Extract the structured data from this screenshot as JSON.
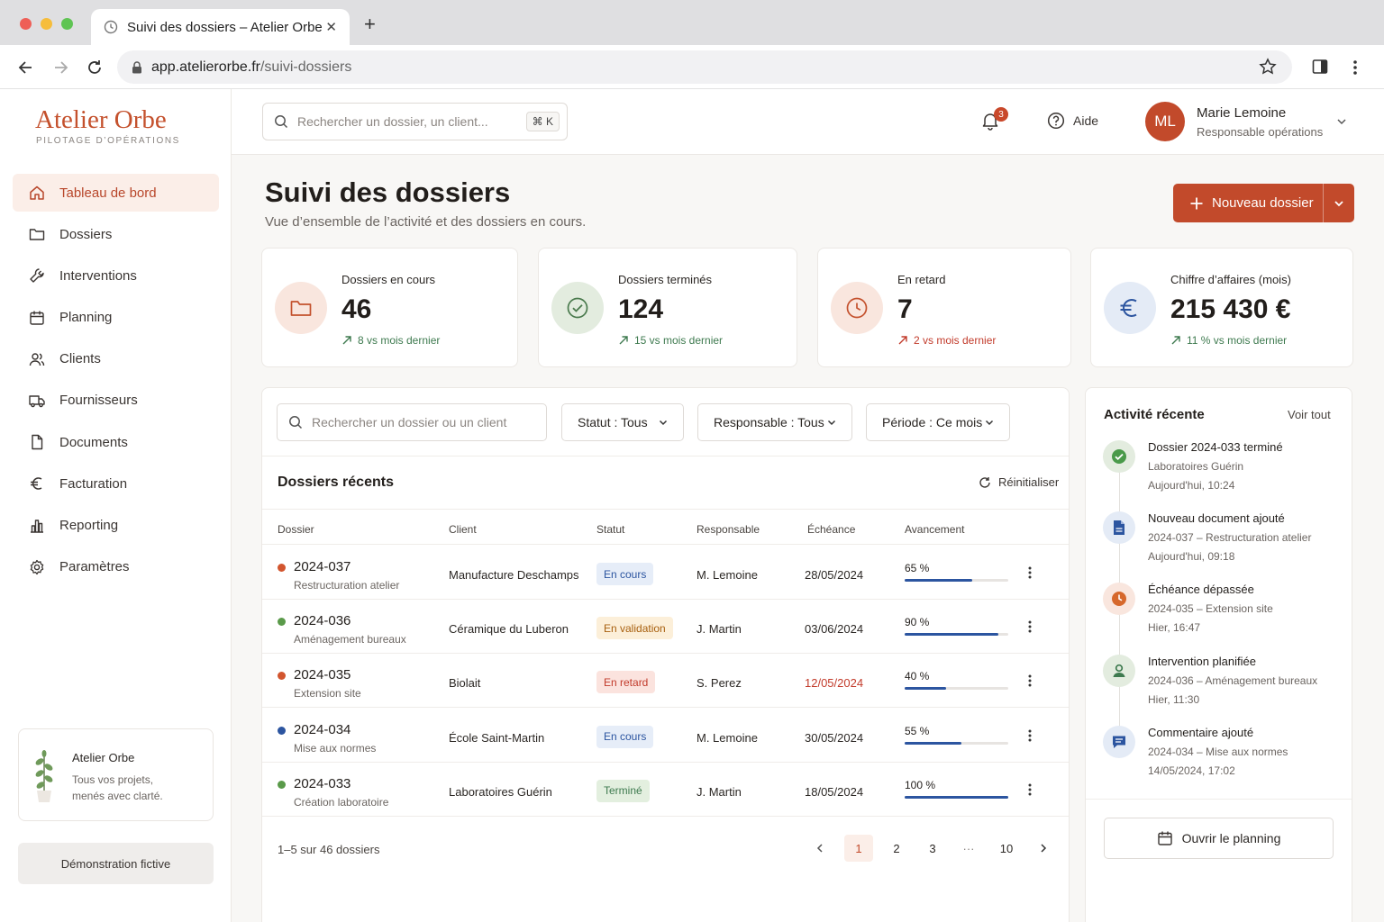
{
  "browser": {
    "tab_title": "Suivi des dossiers – Atelier Orbe",
    "url_host": "app.atelierorbe.fr",
    "url_path": "/suivi-dossiers"
  },
  "brand": {
    "name": "Atelier Orbe",
    "tagline": "PILOTAGE D’OPÉRATIONS",
    "accent": "#c24a2b"
  },
  "sidebar": {
    "items": [
      {
        "label": "Tableau de bord",
        "icon": "home-icon",
        "active": true
      },
      {
        "label": "Dossiers",
        "icon": "folder-icon"
      },
      {
        "label": "Interventions",
        "icon": "wrench-icon"
      },
      {
        "label": "Planning",
        "icon": "calendar-icon"
      },
      {
        "label": "Clients",
        "icon": "users-icon"
      },
      {
        "label": "Fournisseurs",
        "icon": "truck-icon"
      },
      {
        "label": "Documents",
        "icon": "document-icon"
      },
      {
        "label": "Facturation",
        "icon": "euro-icon"
      },
      {
        "label": "Reporting",
        "icon": "bar-chart-icon"
      },
      {
        "label": "Paramètres",
        "icon": "gear-icon"
      }
    ],
    "promo": {
      "title": "Atelier Orbe",
      "text": "Tous vos projets, menés avec clarté."
    },
    "demo_label": "Démonstration fictive"
  },
  "topbar": {
    "search_placeholder": "Rechercher un dossier, un client...",
    "shortcut": "⌘ K",
    "notifications_count": "3",
    "help_label": "Aide",
    "user": {
      "initials": "ML",
      "name": "Marie Lemoine",
      "role": "Responsable opérations"
    }
  },
  "page": {
    "title": "Suivi des dossiers",
    "subtitle": "Vue d’ensemble de l’activité et des dossiers en cours.",
    "new_button": "Nouveau dossier"
  },
  "kpis": [
    {
      "label": "Dossiers en cours",
      "value": "46",
      "trend": "8 vs mois dernier",
      "icon": "folder-icon",
      "color": "#c4512d",
      "bg": "#f9e6de",
      "trend_color": "#3e7a4f"
    },
    {
      "label": "Dossiers terminés",
      "value": "124",
      "trend": "15 vs mois dernier",
      "icon": "check-circle-icon",
      "color": "#4a7a4d",
      "bg": "#e3ecdf",
      "trend_color": "#3e7a4f"
    },
    {
      "label": "En retard",
      "value": "7",
      "trend": "2 vs mois dernier",
      "icon": "clock-icon",
      "color": "#c4512d",
      "bg": "#f9e6de",
      "trend_color": "#c23b2b"
    },
    {
      "label": "Chiffre d’affaires (mois)",
      "value": "215 430 €",
      "trend": "11 % vs mois dernier",
      "icon": "euro-icon",
      "color": "#2c55a0",
      "bg": "#e4ebf6",
      "trend_color": "#3e7a4f"
    }
  ],
  "filters": {
    "search_placeholder": "Rechercher un dossier ou un client",
    "status": "Statut : Tous",
    "owner": "Responsable : Tous",
    "period": "Période : Ce mois"
  },
  "table": {
    "title": "Dossiers récents",
    "reset_label": "Réinitialiser",
    "columns": [
      "Dossier",
      "Client",
      "Statut",
      "Responsable",
      "Échéance",
      "Avancement"
    ],
    "rows": [
      {
        "id": "2024-037",
        "desc": "Restructuration atelier",
        "client": "Manufacture Deschamps",
        "status": "En cours",
        "owner": "M. Lemoine",
        "due": "28/05/2024",
        "progress_label": "65 %",
        "progress": 0.65,
        "dot": "#d2552e",
        "pill_fg": "#2c55a0",
        "pill_bg": "#e6edf8",
        "due_color": "#2b2724"
      },
      {
        "id": "2024-036",
        "desc": "Aménagement bureaux",
        "client": "Céramique du Luberon",
        "status": "En validation",
        "owner": "J. Martin",
        "due": "03/06/2024",
        "progress_label": "90 %",
        "progress": 0.9,
        "dot": "#5a9a4a",
        "pill_fg": "#a8600f",
        "pill_bg": "#fcefd9",
        "due_color": "#2b2724"
      },
      {
        "id": "2024-035",
        "desc": "Extension site",
        "client": "Biolait",
        "status": "En retard",
        "owner": "S. Perez",
        "due": "12/05/2024",
        "progress_label": "40 %",
        "progress": 0.4,
        "dot": "#d2552e",
        "pill_fg": "#c23b2b",
        "pill_bg": "#fbe3de",
        "due_color": "#c23b2b"
      },
      {
        "id": "2024-034",
        "desc": "Mise aux normes",
        "client": "École Saint-Martin",
        "status": "En cours",
        "owner": "M. Lemoine",
        "due": "30/05/2024",
        "progress_label": "55 %",
        "progress": 0.55,
        "dot": "#2c55a0",
        "pill_fg": "#2c55a0",
        "pill_bg": "#e6edf8",
        "due_color": "#2b2724"
      },
      {
        "id": "2024-033",
        "desc": "Création laboratoire",
        "client": "Laboratoires Guérin",
        "status": "Terminé",
        "owner": "J. Martin",
        "due": "18/05/2024",
        "progress_label": "100 %",
        "progress": 1.0,
        "dot": "#5a9a4a",
        "pill_fg": "#3e7a4f",
        "pill_bg": "#e3efdf",
        "due_color": "#2b2724"
      }
    ],
    "pagination": {
      "summary": "1–5 sur 46 dossiers",
      "pages": [
        "1",
        "2",
        "3",
        "···",
        "10"
      ],
      "current": "1"
    }
  },
  "activity": {
    "title": "Activité récente",
    "see_all": "Voir tout",
    "items": [
      {
        "title": "Dossier 2024-033 terminé",
        "sub": "Laboratoires Guérin",
        "date": "Aujourd'hui, 10:24",
        "icon": "check-icon",
        "bg": "#e3ecdf",
        "fg": "#4a9a4a"
      },
      {
        "title": "Nouveau document ajouté",
        "sub": "2024-037 – Restructuration atelier",
        "date": "Aujourd'hui, 09:18",
        "icon": "document-icon",
        "bg": "#e4ebf6",
        "fg": "#2c55a0"
      },
      {
        "title": "Échéance dépassée",
        "sub": "2024-035 – Extension site",
        "date": "Hier, 16:47",
        "icon": "clock-icon",
        "bg": "#f9e6de",
        "fg": "#d6682c"
      },
      {
        "title": "Intervention planifiée",
        "sub": "2024-036 – Aménagement bureaux",
        "date": "Hier, 11:30",
        "icon": "user-icon",
        "bg": "#e3ecdf",
        "fg": "#3e7a4f"
      },
      {
        "title": "Commentaire ajouté",
        "sub": "2024-034 – Mise aux normes",
        "date": "14/05/2024, 17:02",
        "icon": "comment-icon",
        "bg": "#e4ebf6",
        "fg": "#2c55a0"
      }
    ],
    "planning_button": "Ouvrir le planning"
  }
}
